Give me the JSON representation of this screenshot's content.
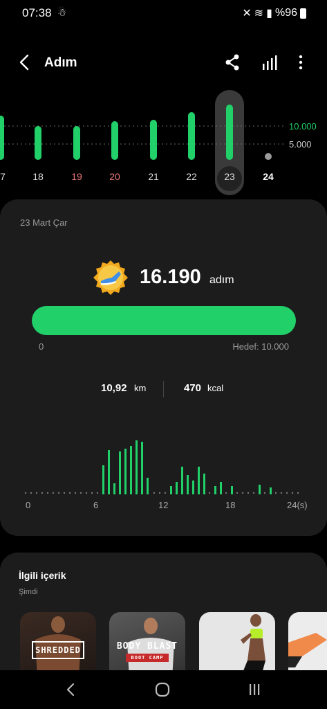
{
  "status": {
    "time": "07:38",
    "battery": "%96"
  },
  "header": {
    "title": "Adım"
  },
  "strip": {
    "grid_high": "10.000",
    "grid_low": "5.000",
    "days": [
      "7",
      "18",
      "19",
      "20",
      "21",
      "22",
      "23",
      "24"
    ]
  },
  "summary": {
    "date": "23 Mart Çar",
    "steps": "16.190",
    "steps_unit": "adım",
    "progress_start": "0",
    "goal": "Hedef: 10.000",
    "distance": "10,92",
    "distance_unit": "km",
    "calories": "470",
    "calories_unit": "kcal"
  },
  "hourly": {
    "ticks": [
      "0",
      "6",
      "12",
      "18",
      "24(s)"
    ]
  },
  "related": {
    "title": "İlgili içerik",
    "subtitle": "Şimdi",
    "items": [
      {
        "label": "SHREDDED"
      },
      {
        "label": "BODY BLAST",
        "sub": "BOOT CAMP"
      }
    ]
  },
  "colors": {
    "accent": "#21d068",
    "weekend": "#f07a7a",
    "card": "#1c1c1c"
  }
}
